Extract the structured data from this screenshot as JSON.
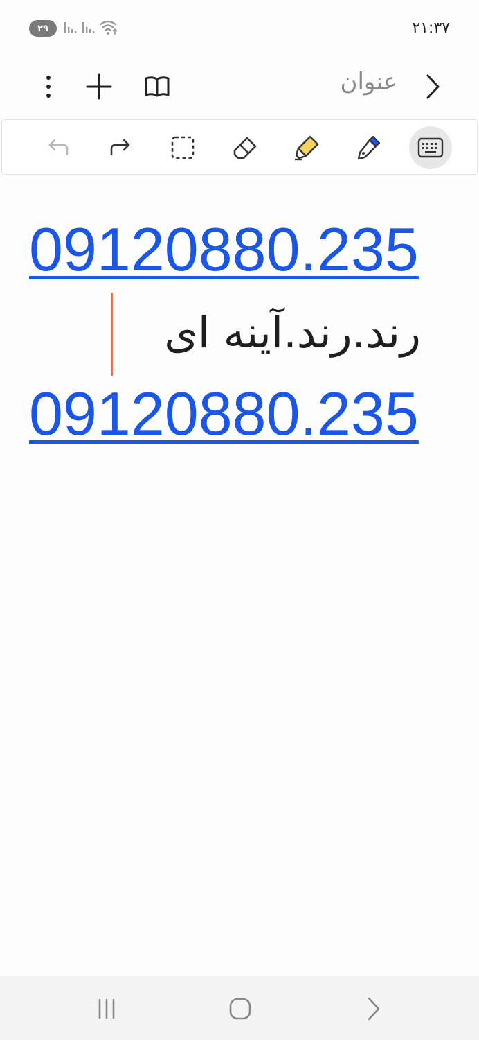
{
  "status_bar": {
    "battery": "۲۹",
    "time": "۲۱:۳۷",
    "icons": [
      "signal-icon",
      "signal-icon",
      "wifi-icon"
    ]
  },
  "title_bar": {
    "title": "عنوان",
    "icons": [
      "more-icon",
      "plus-icon",
      "book-icon",
      "chevron-right-icon"
    ]
  },
  "toolbar": {
    "tools": [
      "undo-icon",
      "redo-icon",
      "selection-icon",
      "eraser-icon",
      "highlighter-icon",
      "pen-icon",
      "keyboard-icon"
    ],
    "active_tool": "keyboard",
    "highlighter_color": "#f4d35e",
    "pen_color": "#1a56e8"
  },
  "note": {
    "lines": [
      "09120880.235",
      "رند.رند.آینه ای",
      "09120880.235"
    ],
    "link_color": "#1a56e8",
    "cursor_color": "#e8734a"
  },
  "nav_bar": {
    "icons": [
      "recents-icon",
      "home-icon",
      "back-icon"
    ]
  }
}
